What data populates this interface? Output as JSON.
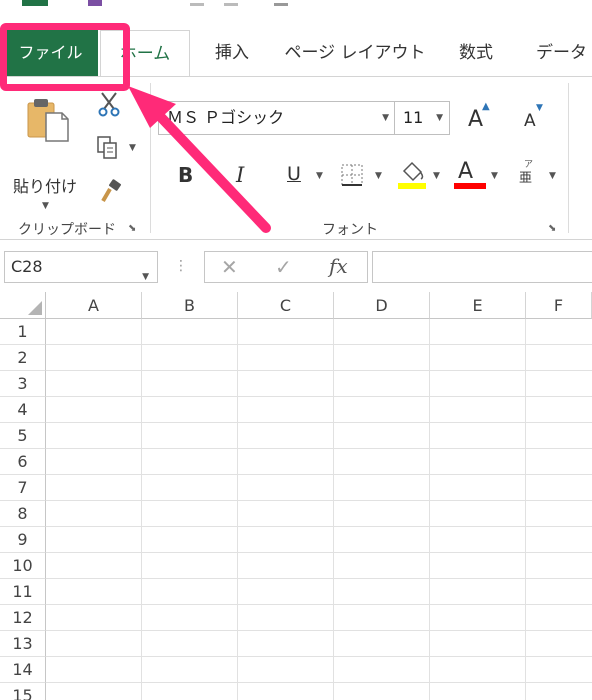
{
  "tabs": {
    "file": "ファイル",
    "home": "ホーム",
    "insert": "挿入",
    "page_layout": "ページ レイアウト",
    "formulas": "数式",
    "data": "データ"
  },
  "clipboard": {
    "paste_label": "貼り付け",
    "group_label": "クリップボード"
  },
  "font": {
    "group_label": "フォント",
    "font_name": "ＭＳ Ｐゴシック",
    "font_size": "11",
    "bold": "B",
    "italic": "I",
    "underline": "U",
    "grow_label": "A",
    "shrink_label": "A",
    "font_color_label": "A",
    "phonetic_label": "亜"
  },
  "formula_bar": {
    "name_box": "C28",
    "cancel": "✕",
    "enter": "✓",
    "fx": "fx",
    "dots": "⋮"
  },
  "columns": [
    "A",
    "B",
    "C",
    "D",
    "E",
    "F"
  ],
  "rows": [
    "1",
    "2",
    "3",
    "4",
    "5",
    "6",
    "7",
    "8",
    "9",
    "10",
    "11",
    "12",
    "13",
    "14",
    "15"
  ],
  "colors": {
    "file_tab": "#217346",
    "highlight": "#ff2a78",
    "fill_color_bar": "#ffff00",
    "font_color_bar": "#ff0000"
  }
}
